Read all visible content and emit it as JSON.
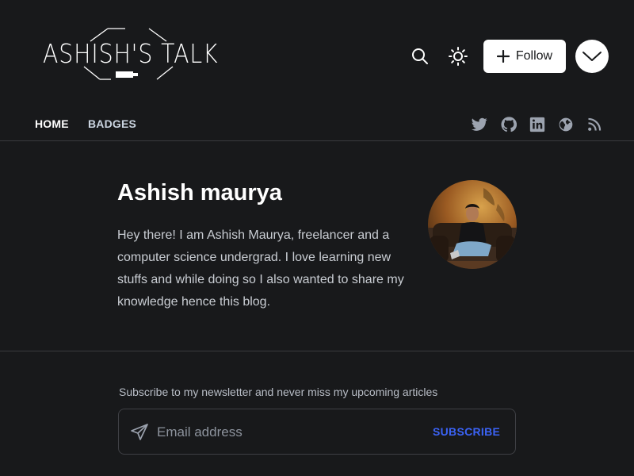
{
  "header": {
    "logo_text": "ASHISH'S TALK",
    "follow_label": "Follow",
    "icons": [
      "search-icon",
      "sun-icon",
      "plus-icon",
      "chevron-down-icon"
    ]
  },
  "nav": {
    "links": [
      {
        "label": "HOME",
        "active": true
      },
      {
        "label": "BADGES",
        "active": false
      }
    ],
    "social": [
      "twitter-icon",
      "github-icon",
      "linkedin-icon",
      "globe-icon",
      "rss-icon"
    ]
  },
  "bio": {
    "name": "Ashish maurya",
    "text": "Hey there! I am Ashish Maurya, freelancer and a computer science undergrad. I love learning new stuffs and while doing so I also wanted to share my knowledge hence this blog."
  },
  "newsletter": {
    "caption": "Subscribe to my newsletter and never miss my upcoming articles",
    "email_placeholder": "Email address",
    "subscribe_label": "SUBSCRIBE"
  },
  "colors": {
    "background": "#18191b",
    "accent": "#3b63f6",
    "divider": "#3a3b3e"
  }
}
